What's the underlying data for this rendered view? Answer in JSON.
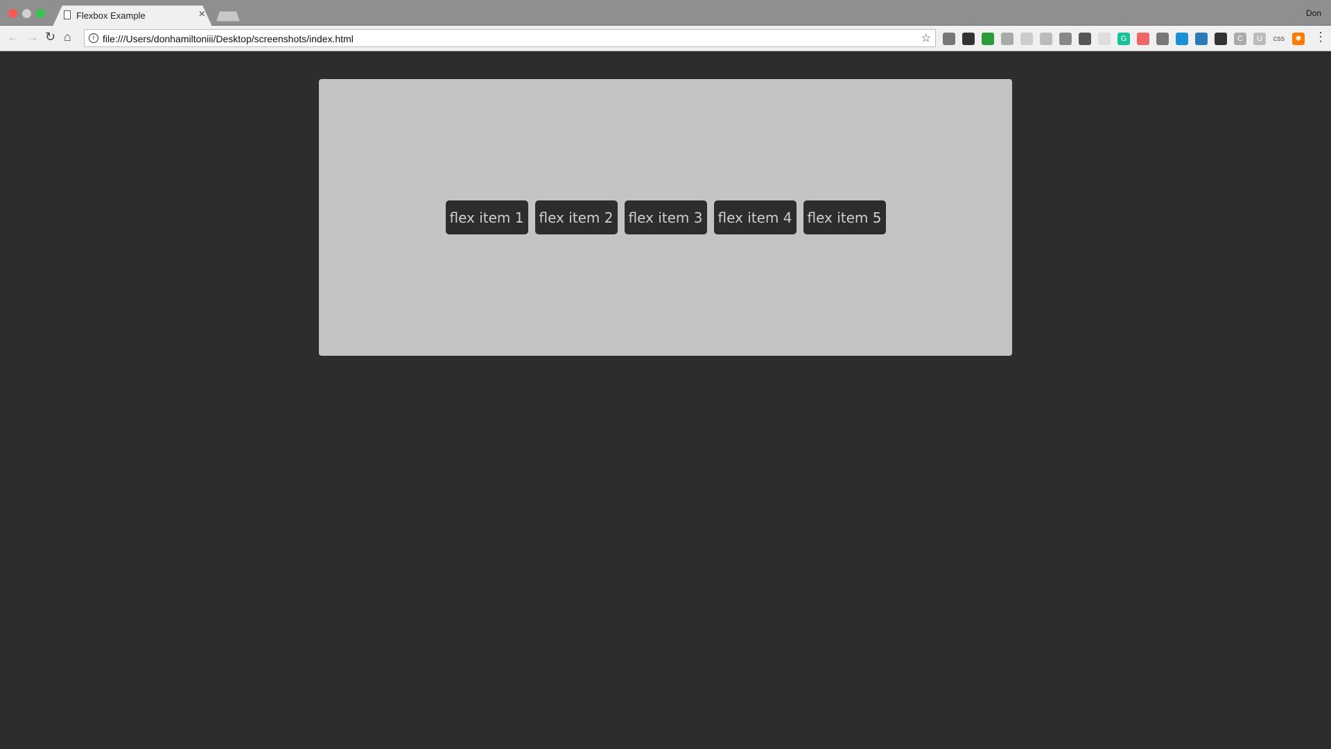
{
  "browser": {
    "tab_title": "Flexbox Example",
    "tab_close": "×",
    "user": "Don",
    "url": "file:///Users/donhamiltoniii/Desktop/screenshots/index.html",
    "extensions": [
      "settings-gear",
      "screenshot",
      "green-ext",
      "k-ext",
      "sync-ext",
      "dropbox",
      "layers",
      "pocket",
      "react",
      "grammarly",
      "rainbow-arc",
      "book",
      "vue-devtools",
      "grid",
      "contrast",
      "c-ext",
      "u-ext",
      "css",
      "hubspot"
    ],
    "extension_labels": {
      "grammarly": "G",
      "c-ext": "C",
      "css": "css",
      "u-ext": "U",
      "hubspot": "✱"
    }
  },
  "page": {
    "items": [
      "flex item 1",
      "flex item 2",
      "flex item 3",
      "flex item 4",
      "flex item 5"
    ],
    "colors": {
      "background": "#2d2d2d",
      "container": "#c4c4c4",
      "item": "#2d2d2d",
      "item_text": "#d0d0d0"
    }
  }
}
